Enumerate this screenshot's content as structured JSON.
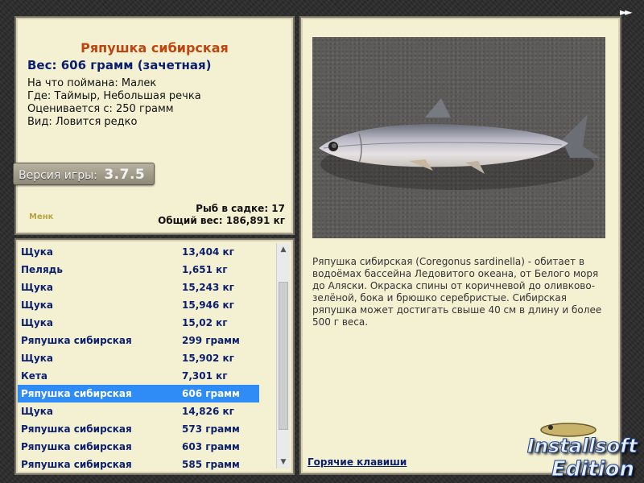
{
  "nav_arrows": "►►",
  "fish": {
    "name": "Ряпушка сибирская",
    "weight_line": "Вес: 606 грамм (зачетная)",
    "caught_with": {
      "label": "На что поймана:",
      "value": "Малек"
    },
    "location": {
      "label": "Где:",
      "value": "Таймыр, Небольшая речка"
    },
    "min_weight": {
      "label": "Оценивается с:",
      "value": "250 грамм"
    },
    "rarity": {
      "label": "Вид:",
      "value": "Ловится редко"
    }
  },
  "version": {
    "label": "Версия игры:",
    "number": "3.7.5"
  },
  "small_logo": "Менк",
  "keepnet": {
    "count_line": "Рыб в садке: 17",
    "total_line": "Общий вес: 186,891 кг"
  },
  "catch_list": [
    {
      "name": "Щука",
      "weight": "13,404 кг"
    },
    {
      "name": "Пелядь",
      "weight": "1,651 кг"
    },
    {
      "name": "Щука",
      "weight": "15,243 кг"
    },
    {
      "name": "Щука",
      "weight": "15,946 кг"
    },
    {
      "name": "Щука",
      "weight": "15,02 кг"
    },
    {
      "name": "Ряпушка сибирская",
      "weight": "299 грамм"
    },
    {
      "name": "Щука",
      "weight": "15,902 кг"
    },
    {
      "name": "Кета",
      "weight": "7,301 кг"
    },
    {
      "name": "Ряпушка сибирская",
      "weight": "606 грамм",
      "selected": true
    },
    {
      "name": "Щука",
      "weight": "14,826 кг"
    },
    {
      "name": "Ряпушка сибирская",
      "weight": "573 грамм"
    },
    {
      "name": "Ряпушка сибирская",
      "weight": "603 грамм"
    },
    {
      "name": "Ряпушка сибирская",
      "weight": "585 грамм"
    }
  ],
  "description": "Ряпушка сибирская (Coregonus sardinella) - обитает в водоёмах бассейна Ледовитого океана, от Белого моря до Аляски. Окраска спины от коричневой до оливково-зелёной, бока и брюшко серебристые. Сибирская ряпушка может достигать свыше 40 см в длину и более 500 г веса.",
  "hotkeys_link": "Горячие клавиши",
  "brand": {
    "line1": "Installsoft",
    "line2": "Edition"
  },
  "colors": {
    "title": "#c0440d",
    "list_text": "#0c1f6e",
    "selection": "#2f8cf6",
    "panel": "#f4f1d3"
  }
}
